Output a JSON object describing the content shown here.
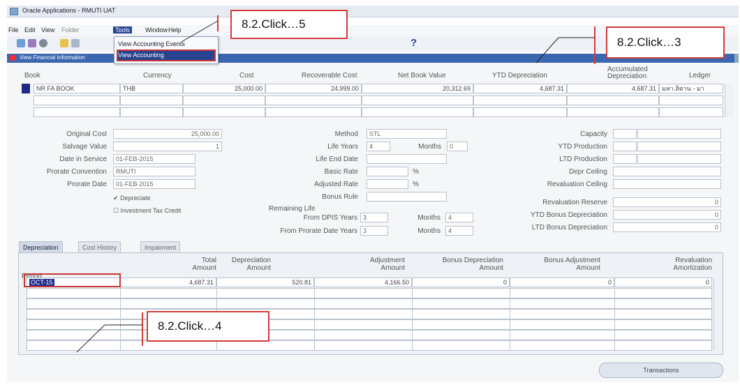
{
  "window": {
    "title": "Oracle Applications - RMUTI UAT"
  },
  "menu": {
    "items": [
      "File",
      "Edit",
      "View",
      "Folder",
      "Tools",
      "Window",
      "Help"
    ],
    "active": "Tools"
  },
  "tools_menu": {
    "items": [
      "View Accounting Events",
      "View Accounting"
    ],
    "selected": "View Accounting"
  },
  "header": {
    "title": "View Financial Information"
  },
  "grid": {
    "columns": [
      "Book",
      "Currency",
      "Cost",
      "Recoverable Cost",
      "Net Book Value",
      "YTD Depreciation",
      "Accumulated Depreciation",
      "Ledger"
    ],
    "accumulated_line1": "Accumulated",
    "accumulated_line2": "Depreciation",
    "row1": {
      "book": "NR FA BOOK",
      "currency": "THB",
      "cost": "25,000.00",
      "recoverable": "24,999.00",
      "nbv": "20,312.69",
      "ytd": "4,687.31",
      "accum": "4,687.31",
      "ledger": "มหา.สิตาน - มา"
    }
  },
  "left_fields": {
    "original_cost": {
      "label": "Original Cost",
      "value": "25,000.00"
    },
    "salvage_value": {
      "label": "Salvage Value",
      "value": "1"
    },
    "date_in_service": {
      "label": "Date in Service",
      "value": "01-FEB-2015"
    },
    "prorate_convention": {
      "label": "Prorate Convention",
      "value": "RMUTI"
    },
    "prorate_date": {
      "label": "Prorate Date",
      "value": "01-FEB-2015"
    },
    "depreciate": "Depreciate",
    "investment_tax_credit": "Investment Tax Credit"
  },
  "middle_fields": {
    "method": {
      "label": "Method",
      "value": "STL"
    },
    "life_years": {
      "label": "Life Years",
      "value": "4"
    },
    "months": {
      "label": "Months",
      "value": "0"
    },
    "life_end_date": {
      "label": "Life End Date"
    },
    "basic_rate": {
      "label": "Basic Rate",
      "unit": "%"
    },
    "adjusted_rate": {
      "label": "Adjusted Rate",
      "unit": "%"
    },
    "bonus_rule": {
      "label": "Bonus Rule"
    },
    "remaining_life": "Remaining Life",
    "from_dpis_years": {
      "label": "From DPIS Years",
      "value": "3"
    },
    "dpis_months": {
      "label": "Months",
      "value": "4"
    },
    "from_prorate_years": {
      "label": "From Prorate Date Years",
      "value": "3"
    },
    "prorate_months": {
      "label": "Months",
      "value": "4"
    }
  },
  "right_fields": {
    "capacity": "Capacity",
    "ytd_production": "YTD Production",
    "ltd_production": "LTD Production",
    "depr_ceiling": "Depr Ceiling",
    "revaluation_ceiling": "Revaluation Ceiling",
    "revaluation_reserve": {
      "label": "Revaluation Reserve",
      "value": "0"
    },
    "ytd_bonus": {
      "label": "YTD Bonus Depreciation",
      "value": "0"
    },
    "ltd_bonus": {
      "label": "LTD Bonus Depreciation",
      "value": "0"
    }
  },
  "tabs": [
    "Depreciation",
    "Cost History",
    "Impairment"
  ],
  "dep_table": {
    "columns": [
      {
        "l1": "",
        "l2": "Period"
      },
      {
        "l1": "Total",
        "l2": "Amount"
      },
      {
        "l1": "Depreciation",
        "l2": "Amount"
      },
      {
        "l1": "Adjustment",
        "l2": "Amount"
      },
      {
        "l1": "Bonus Depreciation",
        "l2": "Amount"
      },
      {
        "l1": "Bonus Adjustment",
        "l2": "Amount"
      },
      {
        "l1": "Revaluation",
        "l2": "Amortization"
      }
    ],
    "row1": {
      "period": "OCT-15",
      "total": "4,687.31",
      "dep": "520.81",
      "adj": "4,166.50",
      "bonus_dep": "0",
      "bonus_adj": "0",
      "reval": "0"
    }
  },
  "buttons": {
    "transactions": "Transactions"
  },
  "callouts": {
    "c5": "8.2.Click…5",
    "c3": "8.2.Click…3",
    "c4": "8.2.Click…4"
  }
}
